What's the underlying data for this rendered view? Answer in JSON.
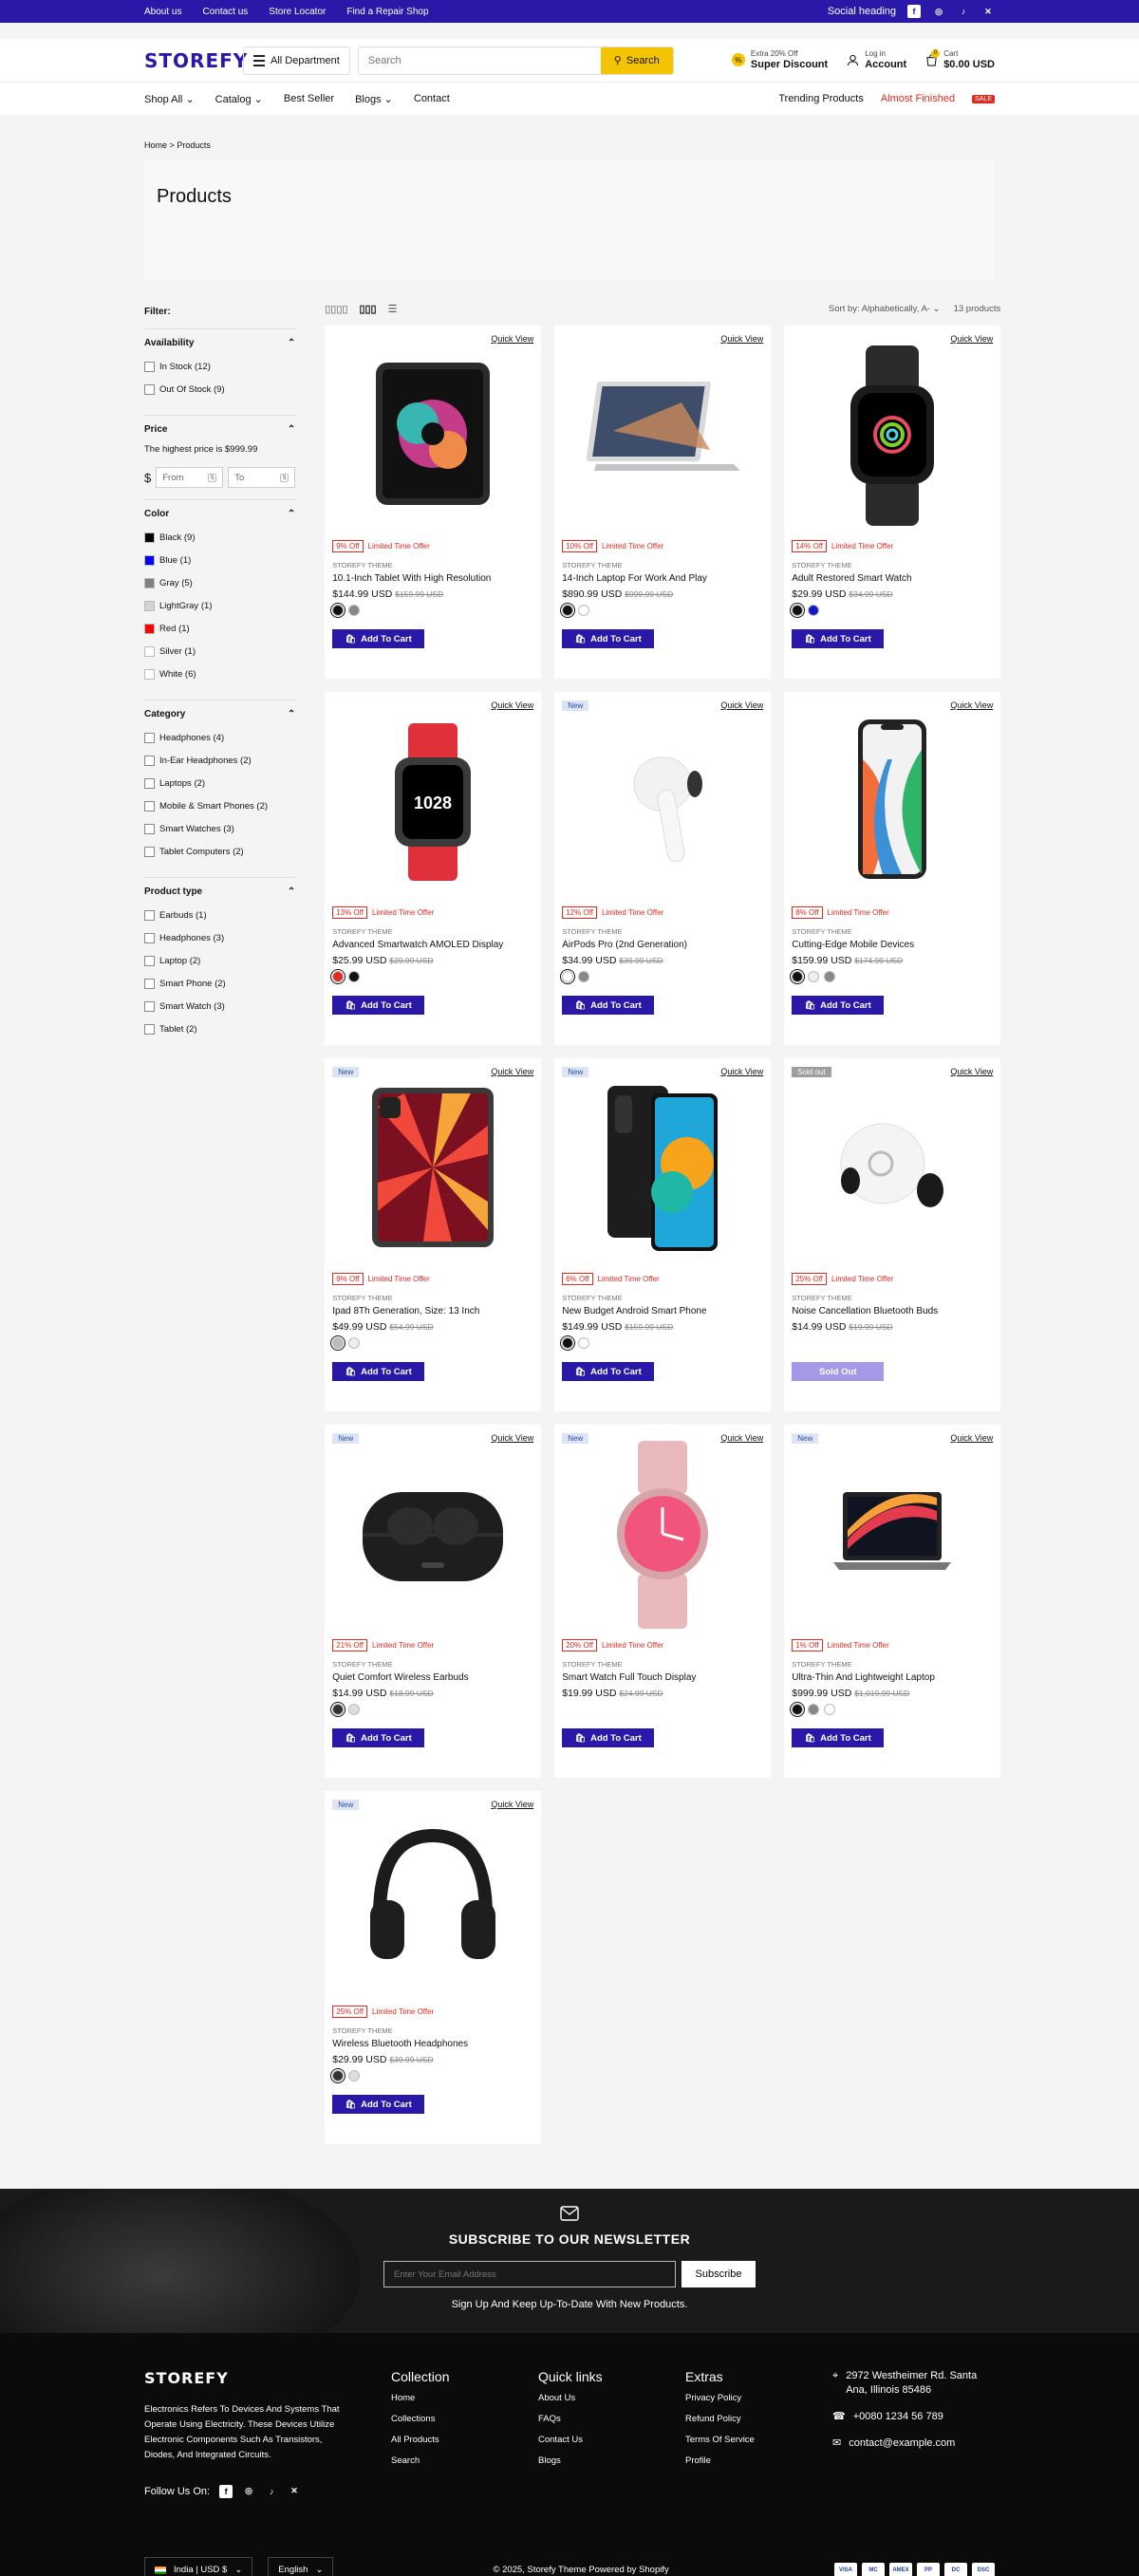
{
  "topbar": {
    "links": [
      "About us",
      "Contact us",
      "Store Locator",
      "Find a Repair Shop"
    ],
    "social_heading": "Social heading"
  },
  "header": {
    "logo": "STOREFY",
    "department": "All Department",
    "search_placeholder": "Search",
    "search_button": "Search",
    "discount_small": "Extra 20% Off",
    "discount_big": "Super Discount",
    "login_small": "Log in",
    "login_big": "Account",
    "cart_small": "Cart",
    "cart_total": "$0.00 USD",
    "cart_count": "0"
  },
  "nav": {
    "items": [
      "Shop All",
      "Catalog",
      "Best Seller",
      "Blogs",
      "Contact"
    ],
    "trending": "Trending Products",
    "almost": "Almost Finished",
    "sale": "SALE"
  },
  "breadcrumb": {
    "home": "Home",
    "sep": ">",
    "current": "Products"
  },
  "page_title": "Products",
  "filters": {
    "label": "Filter:",
    "availability": {
      "title": "Availability",
      "options": [
        "In Stock (12)",
        "Out Of Stock (9)"
      ]
    },
    "price": {
      "title": "Price",
      "note": "The highest price is $999.99",
      "currency": "$",
      "from": "From",
      "to": "To"
    },
    "color": {
      "title": "Color",
      "options": [
        {
          "label": "Black (9)",
          "hex": "#000000"
        },
        {
          "label": "Blue (1)",
          "hex": "#0000ff"
        },
        {
          "label": "Gray (5)",
          "hex": "#808080"
        },
        {
          "label": "LightGray (1)",
          "hex": "#d3d3d3"
        },
        {
          "label": "Red (1)",
          "hex": "#ff0000"
        },
        {
          "label": "Silver (1)",
          "hex": "#ffffff"
        },
        {
          "label": "White (6)",
          "hex": "#ffffff"
        }
      ]
    },
    "category": {
      "title": "Category",
      "options": [
        "Headphones (4)",
        "In-Ear Headphones (2)",
        "Laptops (2)",
        "Mobile & Smart Phones (2)",
        "Smart Watches (3)",
        "Tablet Computers (2)"
      ]
    },
    "product_type": {
      "title": "Product type",
      "options": [
        "Earbuds (1)",
        "Headphones (3)",
        "Laptop (2)",
        "Smart Phone (2)",
        "Smart Watch (3)",
        "Tablet (2)"
      ]
    }
  },
  "toolbar": {
    "sort_label": "Sort by:",
    "sort_value": "Alphabetically, A-",
    "count": "13 products"
  },
  "card_labels": {
    "quick_view": "Quick View",
    "limited": "Limited Time Offer",
    "brand": "STOREFY THEME",
    "add_to_cart": "Add To Cart",
    "sold_out": "Sold Out"
  },
  "products": [
    {
      "name": "10.1-Inch Tablet With High Resolution",
      "price": "$144.99 USD",
      "compare": "$159.99 USD",
      "off": "9% Off",
      "badge": "",
      "image": "tablet",
      "swatches": [
        "#111111",
        "#888888"
      ],
      "sold_out": false
    },
    {
      "name": "14-Inch Laptop For Work And Play",
      "price": "$890.99 USD",
      "compare": "$999.99 USD",
      "off": "10% Off",
      "badge": "",
      "image": "laptop-silver",
      "swatches": [
        "#111111",
        "#ffffff"
      ],
      "sold_out": false
    },
    {
      "name": "Adult Restored Smart Watch",
      "price": "$29.99 USD",
      "compare": "$34.99 USD",
      "off": "14% Off",
      "badge": "",
      "image": "watch-black",
      "swatches": [
        "#111111",
        "#1515c8"
      ],
      "sold_out": false
    },
    {
      "name": "Advanced Smartwatch AMOLED Display",
      "price": "$25.99 USD",
      "compare": "$29.99 USD",
      "off": "13% Off",
      "badge": "",
      "image": "watch-red",
      "swatches": [
        "#e02b20",
        "#111111"
      ],
      "sold_out": false
    },
    {
      "name": "AirPods Pro (2nd Generation)",
      "price": "$34.99 USD",
      "compare": "$39.99 USD",
      "off": "12% Off",
      "badge": "New",
      "image": "airpods",
      "swatches": [
        "#ffffff",
        "#888888"
      ],
      "sold_out": false
    },
    {
      "name": "Cutting-Edge Mobile Devices",
      "price": "$159.99 USD",
      "compare": "$174.99 USD",
      "off": "8% Off",
      "badge": "",
      "image": "phone-iphone",
      "swatches": [
        "#111111",
        "#eeeeee",
        "#888888"
      ],
      "sold_out": false
    },
    {
      "name": "Ipad 8Th Generation, Size: 13 Inch",
      "price": "$49.99 USD",
      "compare": "$54.99 USD",
      "off": "9% Off",
      "badge": "New",
      "image": "ipad",
      "swatches": [
        "#bbbbbb",
        "#eeeeee"
      ],
      "sold_out": false
    },
    {
      "name": "New Budget Android Smart Phone",
      "price": "$149.99 USD",
      "compare": "$159.99 USD",
      "off": "6% Off",
      "badge": "New",
      "image": "phone-android",
      "swatches": [
        "#111111",
        "#ffffff"
      ],
      "sold_out": false
    },
    {
      "name": "Noise Cancellation Bluetooth Buds",
      "price": "$14.99 USD",
      "compare": "$19.99 USD",
      "off": "25% Off",
      "badge": "Sold out",
      "image": "buds",
      "swatches": [],
      "sold_out": true
    },
    {
      "name": "Quiet Comfort Wireless Earbuds",
      "price": "$14.99 USD",
      "compare": "$18.99 USD",
      "off": "21% Off",
      "badge": "New",
      "image": "earbuds-case",
      "swatches": [
        "#333333",
        "#dddddd"
      ],
      "sold_out": false
    },
    {
      "name": "Smart Watch Full Touch Display",
      "price": "$19.99 USD",
      "compare": "$24.99 USD",
      "off": "20% Off",
      "badge": "New",
      "image": "watch-pink",
      "swatches": [],
      "sold_out": false
    },
    {
      "name": "Ultra-Thin And Lightweight Laptop",
      "price": "$999.99 USD",
      "compare": "$1,019.99 USD",
      "off": "1% Off",
      "badge": "New",
      "image": "macbook",
      "swatches": [
        "#111111",
        "#888888",
        "#ffffff"
      ],
      "sold_out": false
    },
    {
      "name": "Wireless Bluetooth Headphones",
      "price": "$29.99 USD",
      "compare": "$39.99 USD",
      "off": "25% Off",
      "badge": "New",
      "image": "headphones",
      "swatches": [
        "#333333",
        "#dddddd"
      ],
      "sold_out": false
    }
  ],
  "newsletter": {
    "title": "SUBSCRIBE TO OUR NEWSLETTER",
    "placeholder": "Enter Your Email Address",
    "button": "Subscribe",
    "subtext": "Sign Up And Keep Up-To-Date With New Products."
  },
  "footer": {
    "logo": "STOREFY",
    "about": "Electronics Refers To Devices And Systems That Operate Using Electricity. These Devices Utilize Electronic Components Such As Transistors, Diodes, And Integrated Circuits.",
    "follow": "Follow Us On:",
    "columns": [
      {
        "title": "Collection",
        "links": [
          "Home",
          "Collections",
          "All Products",
          "Search"
        ]
      },
      {
        "title": "Quick links",
        "links": [
          "About Us",
          "FAQs",
          "Contact Us",
          "Blogs"
        ]
      },
      {
        "title": "Extras",
        "links": [
          "Privacy Policy",
          "Refund Policy",
          "Terms Of Service",
          "Profile"
        ]
      }
    ],
    "address": "2972 Westheimer Rd. Santa Ana, Illinois 85486",
    "phone": "+0080 1234 56 789",
    "email": "contact@example.com",
    "region": "India | USD $",
    "language": "English",
    "copyright": "© 2025, Storefy Theme Powered by Shopify",
    "payments": [
      "VISA",
      "MC",
      "AMEX",
      "PP",
      "DC",
      "DSC"
    ]
  },
  "colors": {
    "brand": "#2a19a8",
    "accent": "#f5c400",
    "sale": "#e02b20"
  }
}
